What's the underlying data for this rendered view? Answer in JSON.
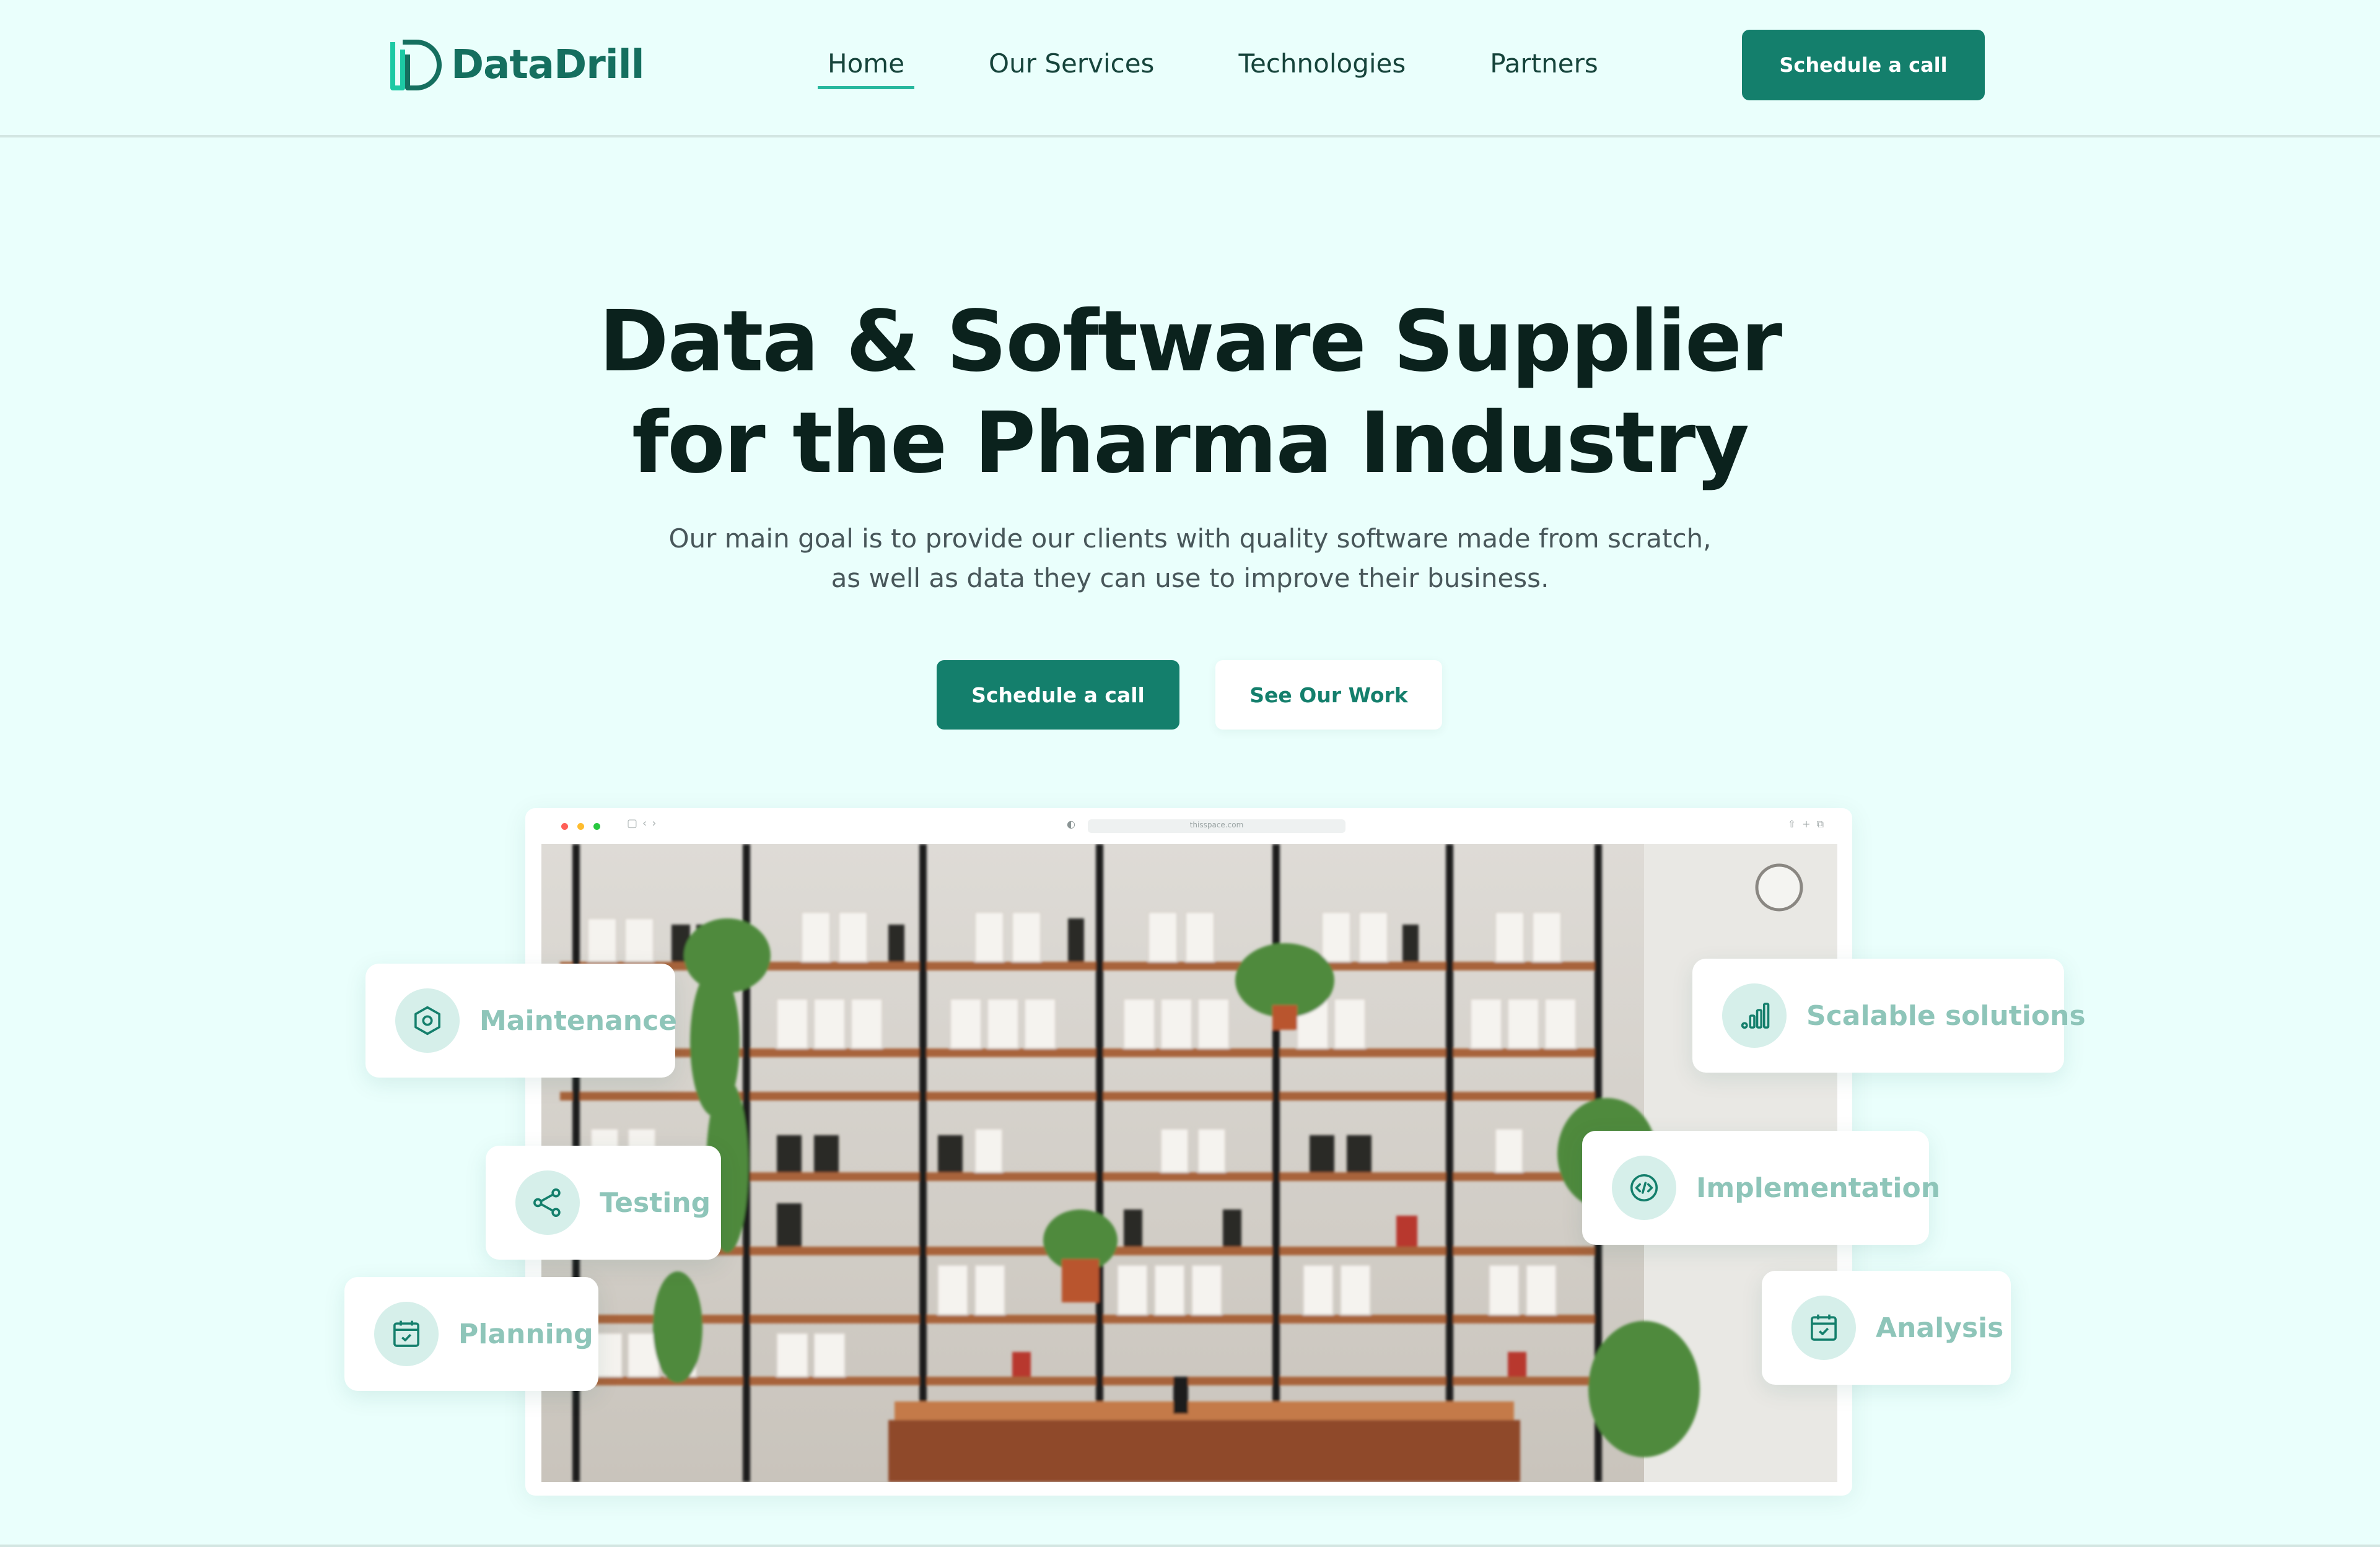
{
  "brand": {
    "name": "DataDrill",
    "logo_icon": "datadrill-logo-icon",
    "accent": "#147f6c"
  },
  "nav": {
    "items": [
      {
        "label": "Home",
        "active": true
      },
      {
        "label": "Our Services",
        "active": false
      },
      {
        "label": "Technologies",
        "active": false
      },
      {
        "label": "Partners",
        "active": false
      }
    ],
    "cta_label": "Schedule a call"
  },
  "hero": {
    "title_line1": "Data & Software Supplier",
    "title_line2": "for the Pharma Industry",
    "subtitle_line1": "Our main goal is to provide our clients with quality software made from scratch,",
    "subtitle_line2": "as well as data they can use to improve their business.",
    "primary_button": "Schedule a call",
    "secondary_button": "See Our Work"
  },
  "browser": {
    "url": "thisspace.com"
  },
  "features": [
    {
      "label": "Maintenance",
      "icon": "hexagon-nut-icon"
    },
    {
      "label": "Testing",
      "icon": "share-nodes-icon"
    },
    {
      "label": "Planning",
      "icon": "calendar-check-icon"
    },
    {
      "label": "Scalable solutions",
      "icon": "bar-chart-icon"
    },
    {
      "label": "Implementation",
      "icon": "code-icon"
    },
    {
      "label": "Analysis",
      "icon": "calendar-check-icon"
    }
  ]
}
